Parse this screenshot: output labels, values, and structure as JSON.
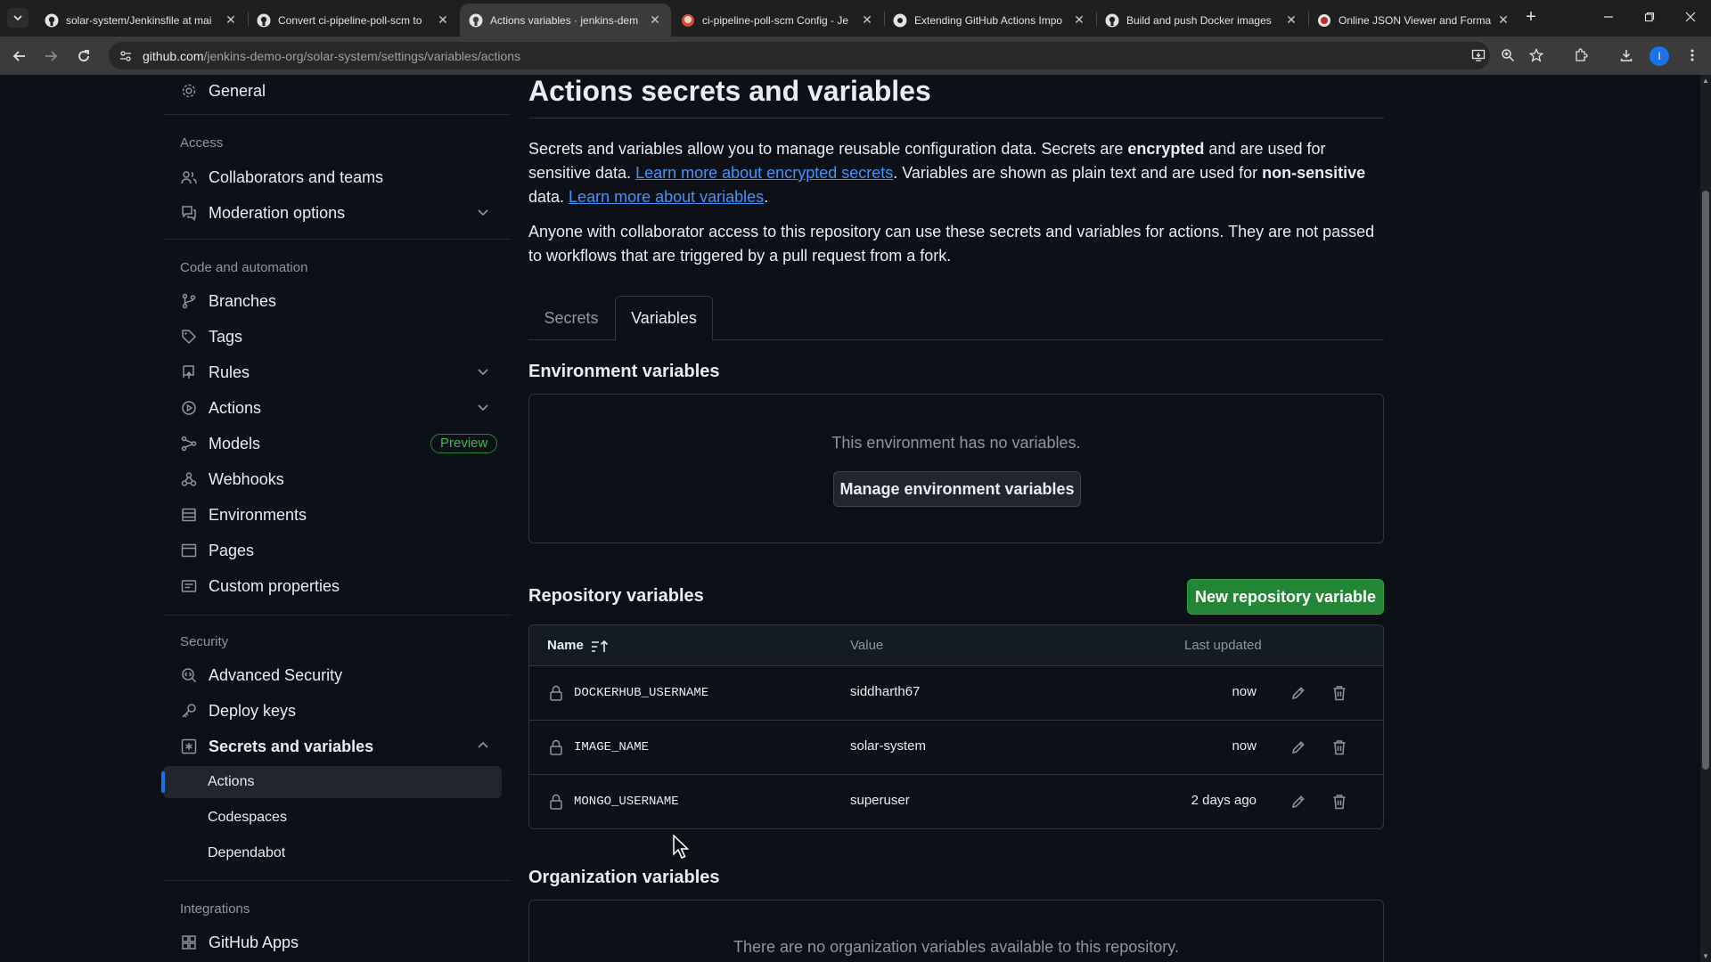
{
  "browser": {
    "tabs": [
      {
        "title": "solar-system/Jenkinsfile at mai",
        "favicon": "github-icon",
        "active": false
      },
      {
        "title": "Convert ci-pipeline-poll-scm to",
        "favicon": "github-icon",
        "active": false
      },
      {
        "title": "Actions variables · jenkins-dem",
        "favicon": "github-icon",
        "active": true
      },
      {
        "title": "ci-pipeline-poll-scm Config - Je",
        "favicon": "jenkins-icon",
        "active": false
      },
      {
        "title": "Extending GitHub Actions Impo",
        "favicon": "github-octo-icon",
        "active": false
      },
      {
        "title": "Build and push Docker images",
        "favicon": "github-icon",
        "active": false
      },
      {
        "title": "Online JSON Viewer and Forma",
        "favicon": "json-icon",
        "active": false
      }
    ],
    "url_host": "github.com",
    "url_path": "/jenkins-demo-org/solar-system/settings/variables/actions",
    "profile_initial": "I"
  },
  "sidebar": {
    "general": "General",
    "access_heading": "Access",
    "collaborators": "Collaborators and teams",
    "moderation": "Moderation options",
    "code_heading": "Code and automation",
    "branches": "Branches",
    "tags": "Tags",
    "rules": "Rules",
    "actions": "Actions",
    "models": "Models",
    "models_badge": "Preview",
    "webhooks": "Webhooks",
    "environments": "Environments",
    "pages": "Pages",
    "custom_properties": "Custom properties",
    "security_heading": "Security",
    "advanced_security": "Advanced Security",
    "deploy_keys": "Deploy keys",
    "secrets_and_variables": "Secrets and variables",
    "sub_actions": "Actions",
    "sub_codespaces": "Codespaces",
    "sub_dependabot": "Dependabot",
    "integrations_heading": "Integrations",
    "github_apps": "GitHub Apps"
  },
  "main": {
    "title": "Actions secrets and variables",
    "intro": {
      "t1": "Secrets and variables allow you to manage reusable configuration data. Secrets are ",
      "b1": "encrypted",
      "t2": " and are used for sensitive data. ",
      "link1": "Learn more about encrypted secrets",
      "t3": ". Variables are shown as plain text and are used for ",
      "b2": "non-sensitive",
      "t4": " data. ",
      "link2": "Learn more about variables",
      "t5": "."
    },
    "access_note": "Anyone with collaborator access to this repository can use these secrets and variables for actions. They are not passed to workflows that are triggered by a pull request from a fork.",
    "tabs": {
      "secrets": "Secrets",
      "variables": "Variables"
    },
    "environment": {
      "heading": "Environment variables",
      "empty": "This environment has no variables.",
      "button": "Manage environment variables"
    },
    "repository": {
      "heading": "Repository variables",
      "new_button": "New repository variable",
      "columns": {
        "name": "Name",
        "value": "Value",
        "updated": "Last updated"
      },
      "rows": [
        {
          "name": "DOCKERHUB_USERNAME",
          "value": "siddharth67",
          "updated": "now"
        },
        {
          "name": "IMAGE_NAME",
          "value": "solar-system",
          "updated": "now"
        },
        {
          "name": "MONGO_USERNAME",
          "value": "superuser",
          "updated": "2 days ago"
        }
      ]
    },
    "organization": {
      "heading": "Organization variables",
      "empty": "There are no organization variables available to this repository."
    }
  }
}
